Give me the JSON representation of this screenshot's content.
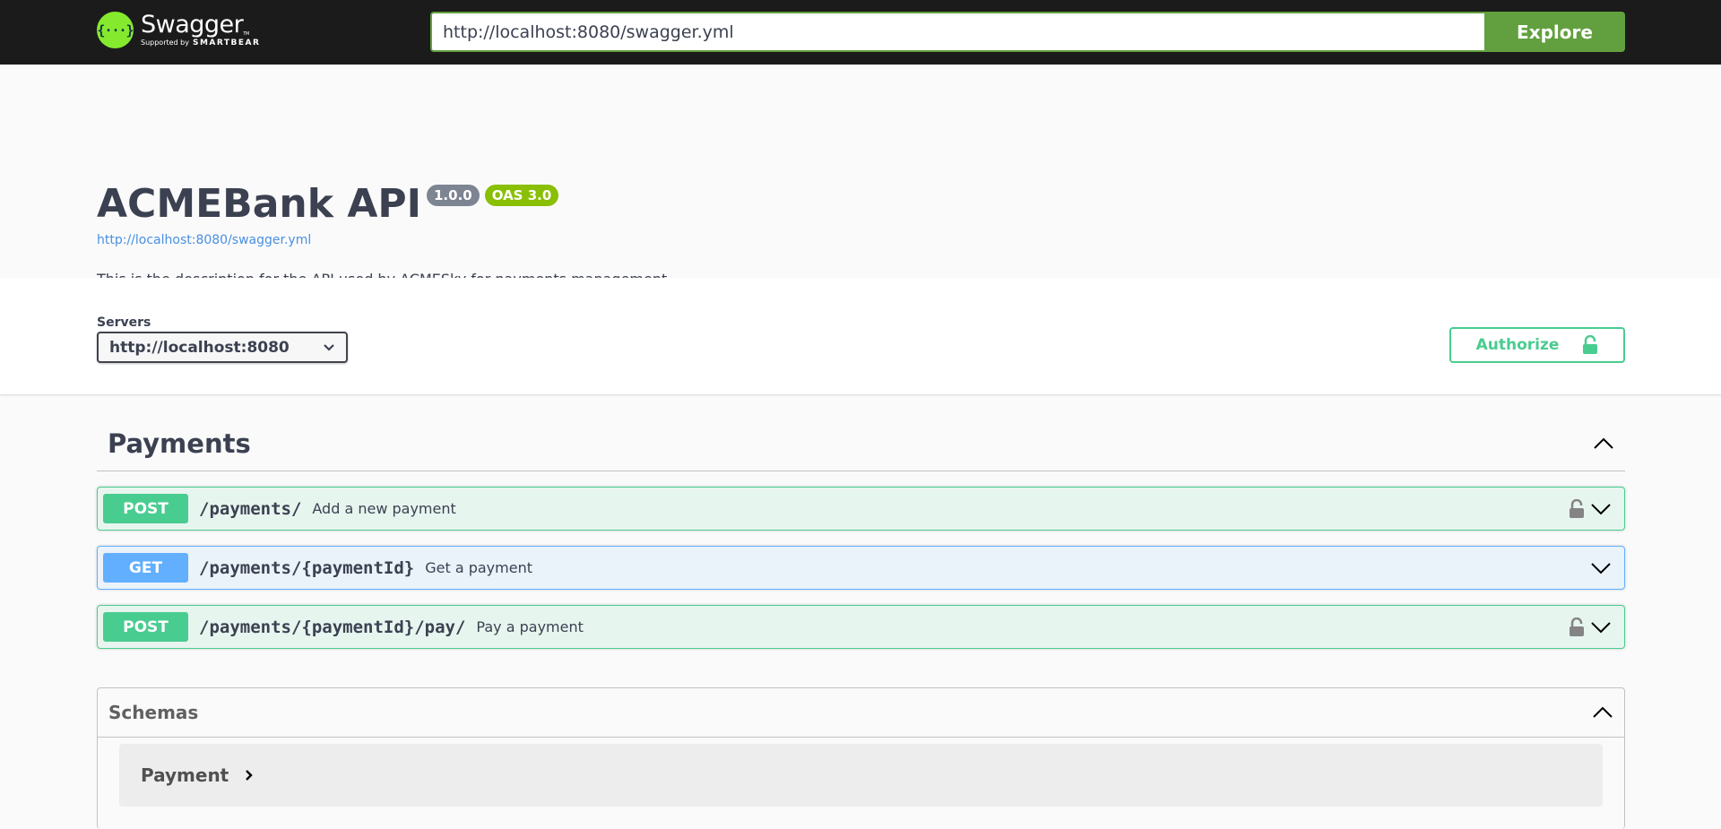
{
  "topbar": {
    "logo": {
      "name": "Swagger",
      "supported_by": "Supported by",
      "company": "SMARTBEAR",
      "glyph": "{···}"
    },
    "url_input": {
      "value": "http://localhost:8080/swagger.yml"
    },
    "explore_label": "Explore"
  },
  "info": {
    "title": "ACMEBank API",
    "version": "1.0.0",
    "oas_badge": "OAS 3.0",
    "spec_url": "http://localhost:8080/swagger.yml",
    "description": "This is the description for the API used by ACMESky for payments management."
  },
  "servers": {
    "label": "Servers",
    "selected": "http://localhost:8080"
  },
  "authorize_label": "Authorize",
  "tag": {
    "name": "Payments",
    "operations": [
      {
        "method": "POST",
        "path": "/payments/",
        "summary": "Add a new payment",
        "locked": true
      },
      {
        "method": "GET",
        "path": "/payments/{paymentId}",
        "summary": "Get a payment",
        "locked": false
      },
      {
        "method": "POST",
        "path": "/payments/{paymentId}/pay/",
        "summary": "Pay a payment",
        "locked": true
      }
    ]
  },
  "schemas": {
    "title": "Schemas",
    "items": [
      {
        "name": "Payment"
      }
    ]
  },
  "colors": {
    "post": "#49cc90",
    "get": "#61affe",
    "explore": "#62a03f",
    "oas_badge": "#89bf04",
    "version_badge": "#7d8492"
  }
}
